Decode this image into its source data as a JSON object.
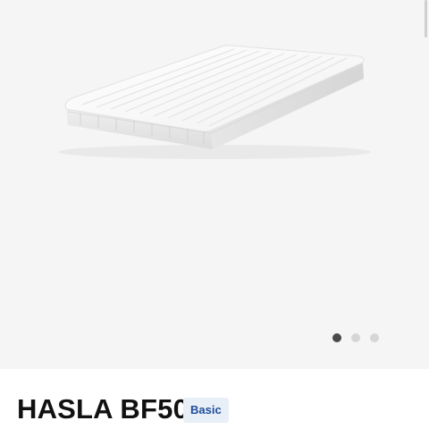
{
  "gallery": {
    "image_icon": "mattress-product-image",
    "slide_count": 3,
    "active_slide": 1,
    "dots": [
      {
        "label": "slide-1",
        "active": true
      },
      {
        "label": "slide-2",
        "active": false
      },
      {
        "label": "slide-3",
        "active": false
      }
    ]
  },
  "product": {
    "title": "HASLA BF50",
    "badge": "Basic"
  },
  "colors": {
    "gallery_bg": "#f5f5f5",
    "dot_active": "#4a4a4a",
    "dot_inactive": "#d6d6d6",
    "badge_bg": "#e9eff7",
    "badge_text": "#1f4e9a"
  }
}
